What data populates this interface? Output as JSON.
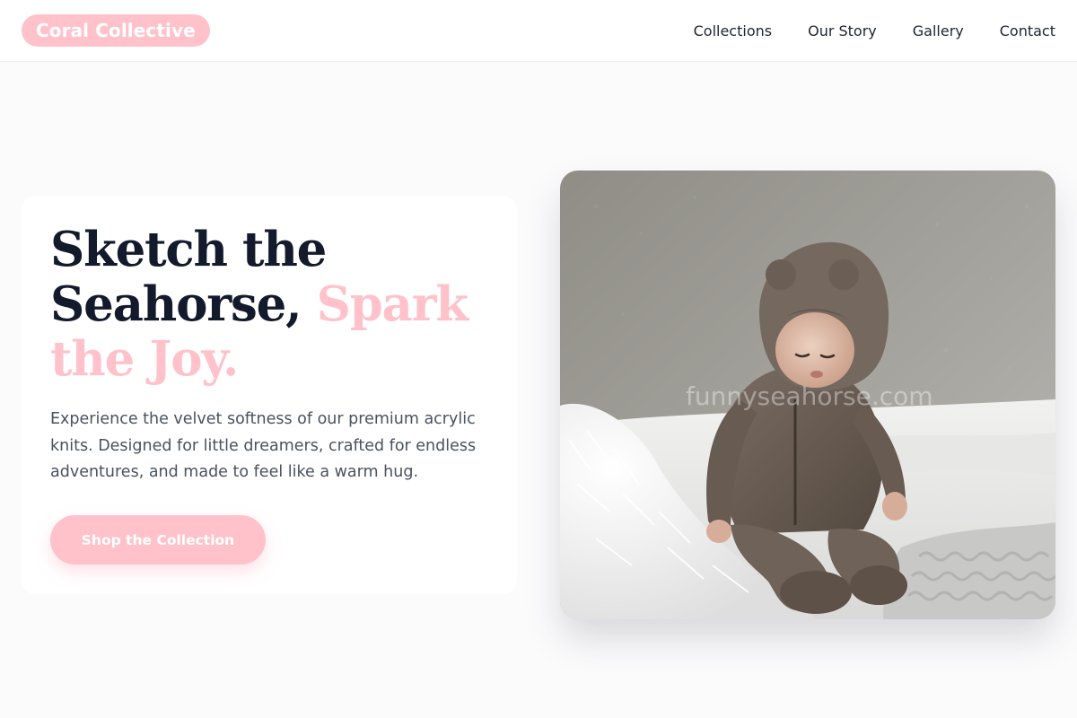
{
  "header": {
    "brand": "Coral Collective",
    "nav": [
      "Collections",
      "Our Story",
      "Gallery",
      "Contact"
    ]
  },
  "hero": {
    "title_part1": "Sketch the Seahorse,",
    "title_accent": "Spark the Joy.",
    "description": "Experience the velvet softness of our premium acrylic knits. Designed for little dreamers, crafted for endless adventures, and made to feel like a warm hug.",
    "cta_label": "Shop the Collection",
    "image_watermark": "funnyseahorse.com"
  },
  "colors": {
    "accent": "#ffc2cb",
    "heading": "#131a2c",
    "body_text": "#4a5160",
    "background": "#fcfbfc"
  }
}
